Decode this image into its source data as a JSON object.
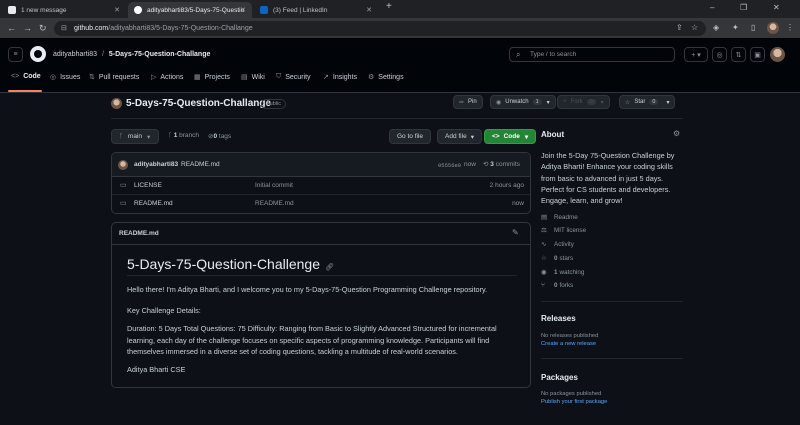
{
  "browser": {
    "tabs": [
      {
        "title": "1 new message",
        "active": false
      },
      {
        "title": "adityabharti83/5-Days-75-Questio",
        "active": true
      },
      {
        "title": "(3) Feed | LinkedIn",
        "active": false
      }
    ],
    "new_tab": "+",
    "url_host": "github.com",
    "url_path": "/adityabharti83/5-Days-75-Question-Challange"
  },
  "header": {
    "owner": "adityabharti83",
    "separator": "/",
    "repo": "5-Days-75-Question-Challange",
    "search_placeholder": "Type / to search"
  },
  "repo_nav": [
    {
      "label": "Code",
      "icon": "<>"
    },
    {
      "label": "Issues",
      "icon": "◎"
    },
    {
      "label": "Pull requests",
      "icon": "⇅"
    },
    {
      "label": "Actions",
      "icon": "▷"
    },
    {
      "label": "Projects",
      "icon": "▦"
    },
    {
      "label": "Wiki",
      "icon": "▤"
    },
    {
      "label": "Security",
      "icon": "⛉"
    },
    {
      "label": "Insights",
      "icon": "↗"
    },
    {
      "label": "Settings",
      "icon": "⚙"
    }
  ],
  "repo_title": {
    "name": "5-Days-75-Question-Challange",
    "visibility": "Public"
  },
  "repo_actions": {
    "pin": "Pin",
    "unwatch": "Unwatch",
    "unwatch_count": "1",
    "fork": "Fork",
    "fork_count": "0",
    "star": "Star",
    "star_count": "0"
  },
  "branch_bar": {
    "branch": "main",
    "branches_count": "1",
    "branches_label": "branch",
    "tags_count": "0",
    "tags_label": "tags",
    "go_to_file": "Go to file",
    "add_file": "Add file",
    "code": "Code"
  },
  "commit": {
    "author": "adityabharti83",
    "message": "README.md",
    "hash": "05556e0",
    "time": "now",
    "commits_count": "3",
    "commits_label": "commits"
  },
  "files": [
    {
      "name": "LICENSE",
      "message": "Initial commit",
      "time": "2 hours ago"
    },
    {
      "name": "README.md",
      "message": "README.md",
      "time": "now"
    }
  ],
  "readme": {
    "file_label": "README.md",
    "title": "5-Days-75-Question-Challenge",
    "p1": "Hello there! I'm Aditya Bharti, and I welcome you to my 5-Days-75-Question Programming Challenge repository.",
    "p2": "Key Challenge Details:",
    "p3": "Duration: 5 Days Total Questions: 75 Difficulty: Ranging from Basic to Slightly Advanced Structured for incremental learning, each day of the challenge focuses on specific aspects of programming knowledge. Participants will find themselves immersed in a diverse set of coding questions, tackling a multitude of real-world scenarios.",
    "p4": "Aditya Bharti CSE"
  },
  "about": {
    "heading": "About",
    "description": "Join the 5-Day 75-Question Challenge by Aditya Bharti! Enhance your coding skills from basic to advanced in just 5 days. Perfect for CS students and developers. Engage, learn, and grow!",
    "readme": "Readme",
    "license": "MIT license",
    "activity": "Activity",
    "stars_count": "0",
    "stars_label": "stars",
    "watching_count": "1",
    "watching_label": "watching",
    "forks_count": "0",
    "forks_label": "forks"
  },
  "releases": {
    "heading": "Releases",
    "note": "No releases published",
    "link": "Create a new release"
  },
  "packages": {
    "heading": "Packages",
    "note": "No packages published",
    "link": "Publish your first package"
  },
  "colors": {
    "code_button": "#238636",
    "link": "#58a6ff",
    "nav_underline": "#f78166"
  }
}
